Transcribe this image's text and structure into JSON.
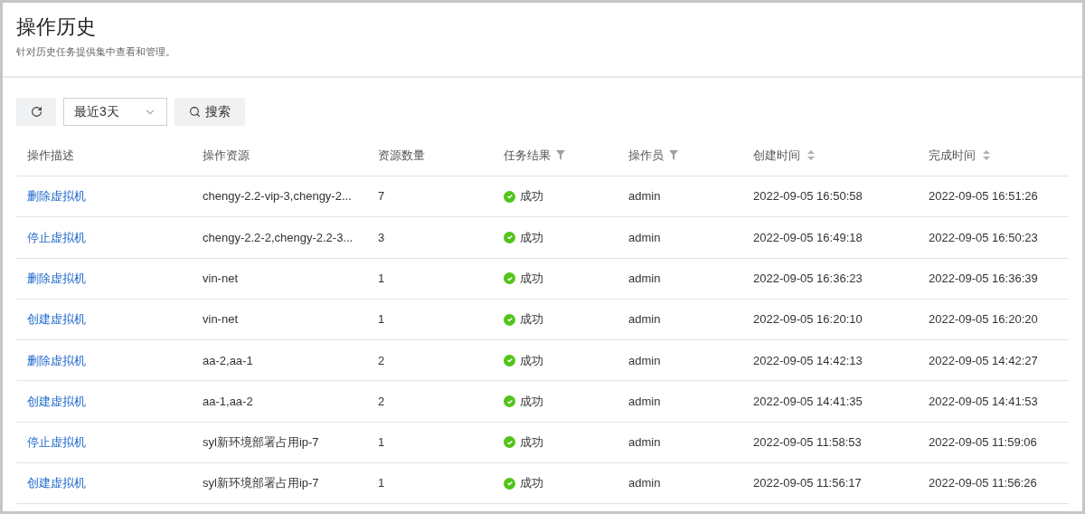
{
  "page": {
    "title": "操作历史",
    "subtitle": "针对历史任务提供集中查看和管理。"
  },
  "toolbar": {
    "time_range": "最近3天",
    "search_button": "搜索"
  },
  "table": {
    "columns": [
      {
        "label": "操作描述",
        "kind": "plain"
      },
      {
        "label": "操作资源",
        "kind": "plain"
      },
      {
        "label": "资源数量",
        "kind": "plain"
      },
      {
        "label": "任务结果",
        "kind": "filter"
      },
      {
        "label": "操作员",
        "kind": "filter"
      },
      {
        "label": "创建时间",
        "kind": "sort"
      },
      {
        "label": "完成时间",
        "kind": "sort"
      }
    ],
    "rows": [
      {
        "description": "删除虚拟机",
        "resources": "chengy-2.2-vip-3,chengy-2...",
        "count": "7",
        "result": {
          "kind": "success",
          "label": "成功"
        },
        "operator": "admin",
        "created": "2022-09-05 16:50:58",
        "finished": "2022-09-05 16:51:26"
      },
      {
        "description": "停止虚拟机",
        "resources": "chengy-2.2-2,chengy-2.2-3...",
        "count": "3",
        "result": {
          "kind": "success",
          "label": "成功"
        },
        "operator": "admin",
        "created": "2022-09-05 16:49:18",
        "finished": "2022-09-05 16:50:23"
      },
      {
        "description": "删除虚拟机",
        "resources": "vin-net",
        "count": "1",
        "result": {
          "kind": "success",
          "label": "成功"
        },
        "operator": "admin",
        "created": "2022-09-05 16:36:23",
        "finished": "2022-09-05 16:36:39"
      },
      {
        "description": "创建虚拟机",
        "resources": "vin-net",
        "count": "1",
        "result": {
          "kind": "success",
          "label": "成功"
        },
        "operator": "admin",
        "created": "2022-09-05 16:20:10",
        "finished": "2022-09-05 16:20:20"
      },
      {
        "description": "删除虚拟机",
        "resources": "aa-2,aa-1",
        "count": "2",
        "result": {
          "kind": "success",
          "label": "成功"
        },
        "operator": "admin",
        "created": "2022-09-05 14:42:13",
        "finished": "2022-09-05 14:42:27"
      },
      {
        "description": "创建虚拟机",
        "resources": "aa-1,aa-2",
        "count": "2",
        "result": {
          "kind": "success",
          "label": "成功"
        },
        "operator": "admin",
        "created": "2022-09-05 14:41:35",
        "finished": "2022-09-05 14:41:53"
      },
      {
        "description": "停止虚拟机",
        "resources": "syl新环境部署占用ip-7",
        "count": "1",
        "result": {
          "kind": "success",
          "label": "成功"
        },
        "operator": "admin",
        "created": "2022-09-05 11:58:53",
        "finished": "2022-09-05 11:59:06"
      },
      {
        "description": "创建虚拟机",
        "resources": "syl新环境部署占用ip-7",
        "count": "1",
        "result": {
          "kind": "success",
          "label": "成功"
        },
        "operator": "admin",
        "created": "2022-09-05 11:56:17",
        "finished": "2022-09-05 11:56:26"
      }
    ]
  }
}
